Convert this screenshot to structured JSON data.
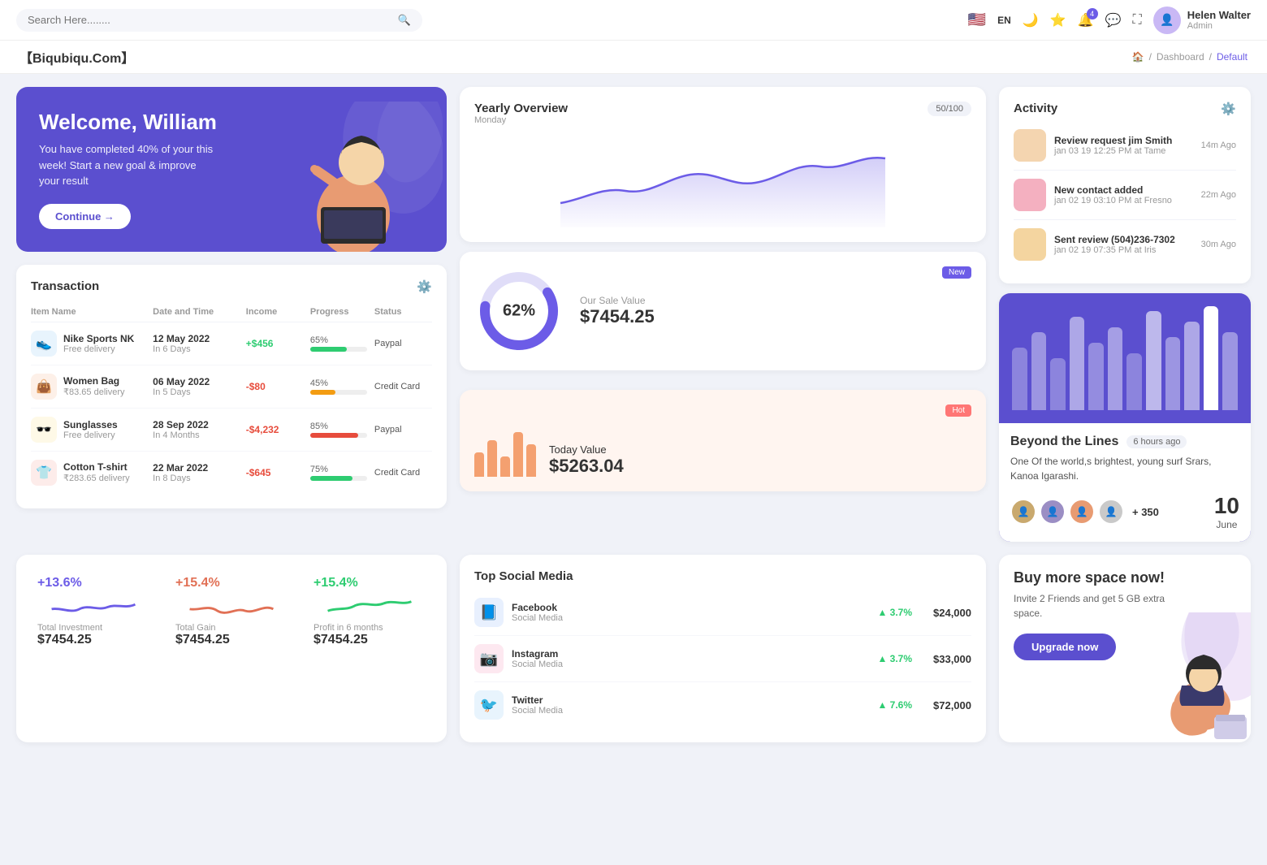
{
  "topnav": {
    "search_placeholder": "Search Here........",
    "lang": "EN",
    "user_name": "Helen Walter",
    "user_role": "Admin",
    "notification_count": "4"
  },
  "breadcrumb": {
    "brand": "【Biqubiqu.Com】",
    "home": "Home",
    "dashboard": "Dashboard",
    "current": "Default"
  },
  "welcome": {
    "title": "Welcome, William",
    "subtitle": "You have completed 40% of your this week! Start a new goal & improve your result",
    "button": "Continue →"
  },
  "yearly": {
    "title": "Yearly Overview",
    "subtitle": "Monday",
    "progress": "50/100"
  },
  "activity": {
    "title": "Activity",
    "items": [
      {
        "title": "Review request jim Smith",
        "meta": "jan 03 19 12:25 PM at Tame",
        "time": "14m Ago"
      },
      {
        "title": "New contact added",
        "meta": "jan 02 19 03:10 PM at Fresno",
        "time": "22m Ago"
      },
      {
        "title": "Sent review (504)236-7302",
        "meta": "jan 02 19 07:35 PM at Iris",
        "time": "30m Ago"
      }
    ]
  },
  "transaction": {
    "title": "Transaction",
    "columns": [
      "Item Name",
      "Date and Time",
      "Income",
      "Progress",
      "Status"
    ],
    "rows": [
      {
        "icon": "👟",
        "icon_bg": "#e8f4fd",
        "name": "Nike Sports NK",
        "sub": "Free delivery",
        "date": "12 May 2022",
        "days": "In 6 Days",
        "income": "+$456",
        "income_type": "pos",
        "progress": 65,
        "progress_color": "#2ecc71",
        "status": "Paypal"
      },
      {
        "icon": "👜",
        "icon_bg": "#fdf0e8",
        "name": "Women Bag",
        "sub": "₹83.65 delivery",
        "date": "06 May 2022",
        "days": "In 5 Days",
        "income": "-$80",
        "income_type": "neg",
        "progress": 45,
        "progress_color": "#f39c12",
        "status": "Credit Card"
      },
      {
        "icon": "🕶️",
        "icon_bg": "#fef9e7",
        "name": "Sunglasses",
        "sub": "Free delivery",
        "date": "28 Sep 2022",
        "days": "In 4 Months",
        "income": "-$4,232",
        "income_type": "neg",
        "progress": 85,
        "progress_color": "#e74c3c",
        "status": "Paypal"
      },
      {
        "icon": "👕",
        "icon_bg": "#fdecea",
        "name": "Cotton T-shirt",
        "sub": "₹283.65 delivery",
        "date": "22 Mar 2022",
        "days": "In 8 Days",
        "income": "-$645",
        "income_type": "neg",
        "progress": 75,
        "progress_color": "#2ecc71",
        "status": "Credit Card"
      }
    ]
  },
  "sale_value": {
    "badge": "New",
    "percentage": "62%",
    "title": "Our Sale Value",
    "value": "$7454.25"
  },
  "today_value": {
    "badge": "Hot",
    "title": "Today Value",
    "value": "$5263.04"
  },
  "beyond": {
    "title": "Beyond the Lines",
    "time": "6 hours ago",
    "description": "One Of the world,s brightest, young surf Srars, Kanoa Igarashi.",
    "plus_count": "+ 350",
    "date_num": "10",
    "date_month": "June"
  },
  "stats": [
    {
      "percent": "+13.6%",
      "label": "Total Investment",
      "value": "$7454.25",
      "color": "#6c5ce7"
    },
    {
      "percent": "+15.4%",
      "label": "Total Gain",
      "value": "$7454.25",
      "color": "#e17055"
    },
    {
      "percent": "+15.4%",
      "label": "Profit in 6 months",
      "value": "$7454.25",
      "color": "#2ecc71"
    }
  ],
  "social": {
    "title": "Top Social Media",
    "items": [
      {
        "icon": "📘",
        "icon_bg": "#e8f0fe",
        "name": "Facebook",
        "sub": "Social Media",
        "growth": "3.7%",
        "amount": "$24,000"
      },
      {
        "icon": "📷",
        "icon_bg": "#fde8f0",
        "name": "Instagram",
        "sub": "Social Media",
        "growth": "3.7%",
        "amount": "$33,000"
      },
      {
        "icon": "🐦",
        "icon_bg": "#e8f4fd",
        "name": "Twitter",
        "sub": "Social Media",
        "growth": "7.6%",
        "amount": "$72,000"
      }
    ]
  },
  "buyspace": {
    "title": "Buy more space now!",
    "description": "Invite 2 Friends and get 5 GB extra space.",
    "button": "Upgrade now"
  }
}
